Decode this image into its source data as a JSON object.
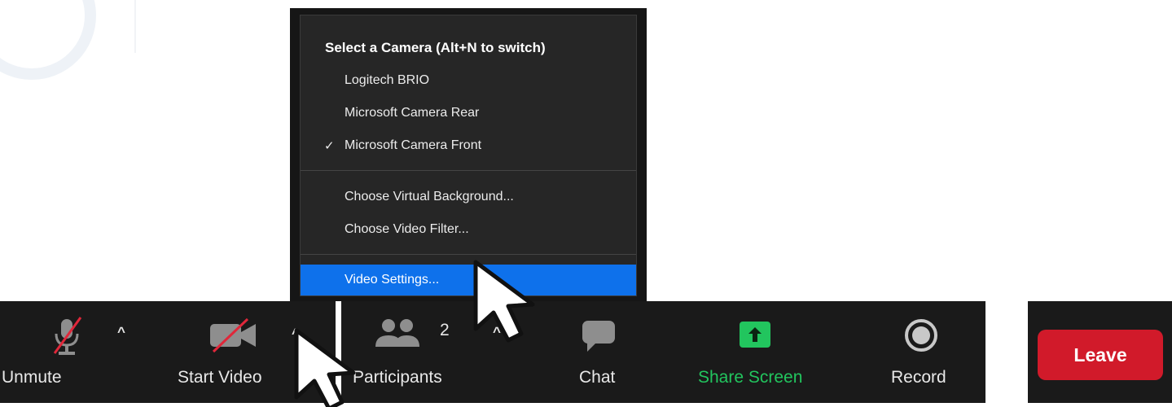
{
  "camera_menu": {
    "header": "Select a Camera (Alt+N to switch)",
    "cameras": [
      {
        "label": "Logitech BRIO",
        "checked": false
      },
      {
        "label": "Microsoft Camera Rear",
        "checked": false
      },
      {
        "label": "Microsoft Camera Front",
        "checked": true
      }
    ],
    "check_mark": "✓",
    "options": [
      {
        "label": "Choose Virtual Background..."
      },
      {
        "label": "Choose Video Filter..."
      }
    ],
    "settings": {
      "label": "Video Settings...",
      "highlighted": true
    }
  },
  "toolbar": {
    "unmute": {
      "label": "Unmute",
      "icon": "muted-microphone-icon"
    },
    "start_video": {
      "label": "Start Video",
      "icon": "video-off-icon"
    },
    "participants": {
      "label": "Participants",
      "count": "2",
      "icon": "participants-icon"
    },
    "chat": {
      "label": "Chat",
      "icon": "chat-bubble-icon"
    },
    "share_screen": {
      "label": "Share Screen",
      "icon": "share-screen-icon"
    },
    "record": {
      "label": "Record",
      "icon": "record-icon"
    },
    "leave": {
      "label": "Leave"
    },
    "caret_glyph": "^"
  },
  "colors": {
    "toolbar_bg": "#1a1a1a",
    "menu_bg": "#262626",
    "highlight": "#0e71eb",
    "share_green": "#22c55e",
    "leave_red": "#d11a2a",
    "mute_slash": "#e0273a"
  }
}
